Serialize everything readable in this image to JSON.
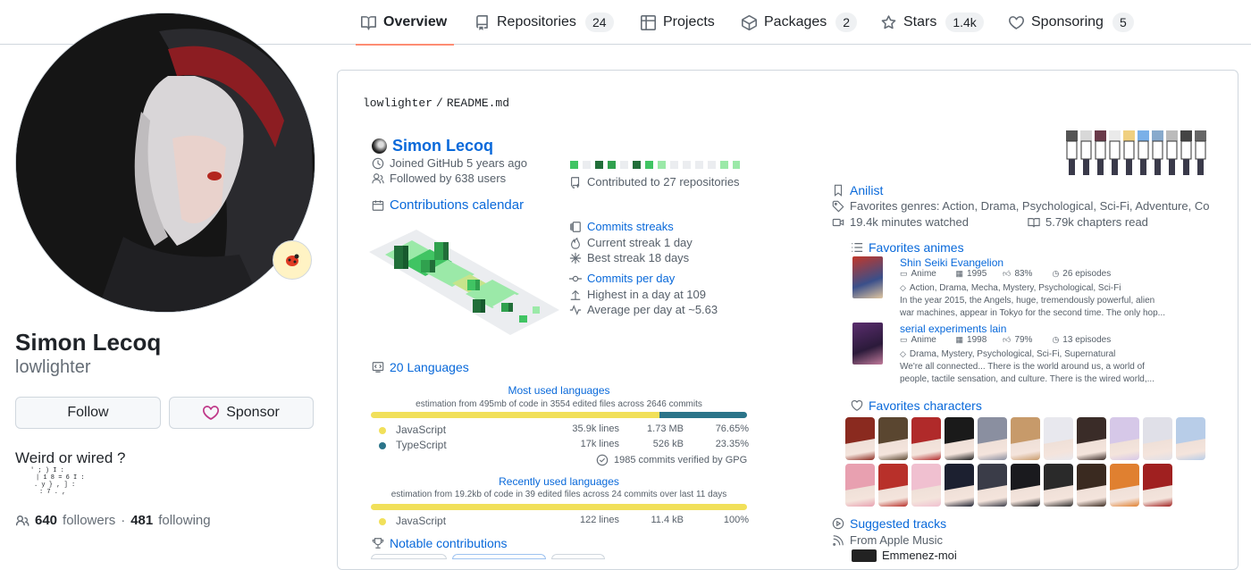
{
  "nav": {
    "tabs": [
      {
        "label": "Overview",
        "icon": "book-icon",
        "count": null
      },
      {
        "label": "Repositories",
        "icon": "repo-icon",
        "count": "24"
      },
      {
        "label": "Projects",
        "icon": "table-icon",
        "count": null
      },
      {
        "label": "Packages",
        "icon": "package-icon",
        "count": "2"
      },
      {
        "label": "Stars",
        "icon": "star-icon",
        "count": "1.4k"
      },
      {
        "label": "Sponsoring",
        "icon": "heart-icon",
        "count": "5"
      }
    ]
  },
  "profile": {
    "fullname": "Simon Lecoq",
    "login": "lowlighter",
    "follow_label": "Follow",
    "sponsor_label": "Sponsor",
    "bio": "Weird or wired ?",
    "followers_count": "640",
    "followers_label": "followers",
    "separator": "·",
    "following_count": "481",
    "following_label": "following",
    "status_icon": "ladybug-emoji-icon"
  },
  "readme": {
    "path_user": "lowlighter",
    "path_sep": "/",
    "path_file": "README.md",
    "name": "Simon Lecoq",
    "joined": "Joined GitHub 5 years ago",
    "followed": "Followed by 638 users",
    "contributed": "Contributed to 27 repositories",
    "calendar_title": "Contributions calendar",
    "streaks_title": "Commits streaks",
    "current_streak": "Current streak 1 day",
    "best_streak": "Best streak 18 days",
    "per_day_title": "Commits per day",
    "highest": "Highest in a day at 109",
    "average": "Average per day at ~5.63",
    "languages_title": "20 Languages",
    "most_used_title": "Most used languages",
    "most_used_estimation": "estimation from 495mb of code in 3554 edited files across 2646 commits",
    "most_used": [
      {
        "name": "JavaScript",
        "lines": "35.9k lines",
        "size": "1.73 MB",
        "percent": "76.65%",
        "color": "#f1e05a",
        "fraction": 0.7665
      },
      {
        "name": "TypeScript",
        "lines": "17k lines",
        "size": "526 kB",
        "percent": "23.35%",
        "color": "#2b7489",
        "fraction": 0.2335
      }
    ],
    "verified": "1985 commits verified by GPG",
    "recent_title": "Recently used languages",
    "recent_estimation": "estimation from 19.2kb of code in 39 edited files across 24 commits over last 11 days",
    "recent": [
      {
        "name": "JavaScript",
        "lines": "122 lines",
        "size": "11.4 kB",
        "percent": "100%",
        "color": "#f1e05a",
        "fraction": 1.0
      }
    ],
    "notable_title": "Notable contributions",
    "anilist_title": "Anilist",
    "genres": "Favorites genres: Action, Drama, Psychological, Sci-Fi, Adventure, Co",
    "minutes": "19.4k minutes watched",
    "chapters": "5.79k chapters read",
    "favorite_animes_title": "Favorites animes",
    "animes": [
      {
        "title": "Shin Seiki Evangelion",
        "type": "Anime",
        "year": "1995",
        "score": "83%",
        "episodes": "26 episodes",
        "tags": "Action, Drama, Mecha, Mystery, Psychological, Sci-Fi",
        "desc1": "In the year 2015, the Angels, huge, tremendously powerful, alien",
        "desc2": "war machines, appear in Tokyo for the second time. The only hop..."
      },
      {
        "title": "serial experiments lain",
        "type": "Anime",
        "year": "1998",
        "score": "79%",
        "episodes": "13 episodes",
        "tags": "Drama, Mystery, Psychological, Sci-Fi, Supernatural",
        "desc1": "We're all connected... There is the world around us, a world of",
        "desc2": "people, tactile sensation, and culture. There is the wired world,..."
      }
    ],
    "favorite_characters_title": "Favorites characters",
    "tracks_title": "Suggested tracks",
    "tracks_source": "From Apple Music",
    "track_partial": "Emmenez-moi"
  },
  "colors": {
    "accent": "#0969da",
    "tab_underline": "#fd8c73",
    "green_dark": "#216e39",
    "green_mid": "#40c463",
    "green_light": "#9be9a8"
  }
}
